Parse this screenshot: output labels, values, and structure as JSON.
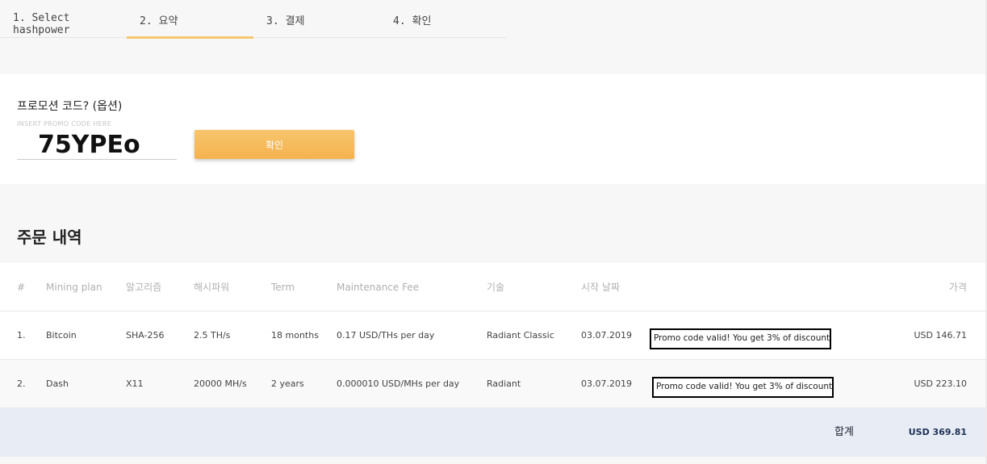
{
  "steps": [
    {
      "label": "1. Select hashpower"
    },
    {
      "label": "2. 요약"
    },
    {
      "label": "3. 결제"
    },
    {
      "label": "4. 확인"
    }
  ],
  "promo": {
    "title": "프로모션 코드? (옵션)",
    "label": "INSERT PROMO CODE HERE",
    "value": "75YPEo",
    "button": "확인"
  },
  "orders": {
    "title": "주문 내역",
    "headers": {
      "num": "#",
      "plan": "Mining plan",
      "algo": "알고리즘",
      "hash": "해시파워",
      "term": "Term",
      "fee": "Maintenance Fee",
      "tech": "기술",
      "date": "시작 날짜",
      "price": "가격"
    },
    "rows": [
      {
        "num": "1.",
        "plan": "Bitcoin",
        "algo": "SHA-256",
        "hash": "2.5 TH/s",
        "term": "18 months",
        "fee": "0.17 USD/THs per day",
        "tech": "Radiant Classic",
        "date": "03.07.2019",
        "note": "Promo code valid! You get 3% of discount",
        "price": "USD 146.71"
      },
      {
        "num": "2.",
        "plan": "Dash",
        "algo": "X11",
        "hash": "20000 MH/s",
        "term": "2 years",
        "fee": "0.000010 USD/MHs per day",
        "tech": "Radiant",
        "date": "03.07.2019",
        "note": "Promo code valid! You get 3% of discount",
        "price": "USD 223.10"
      }
    ],
    "total_label": "합계",
    "total_value": "USD 369.81"
  }
}
